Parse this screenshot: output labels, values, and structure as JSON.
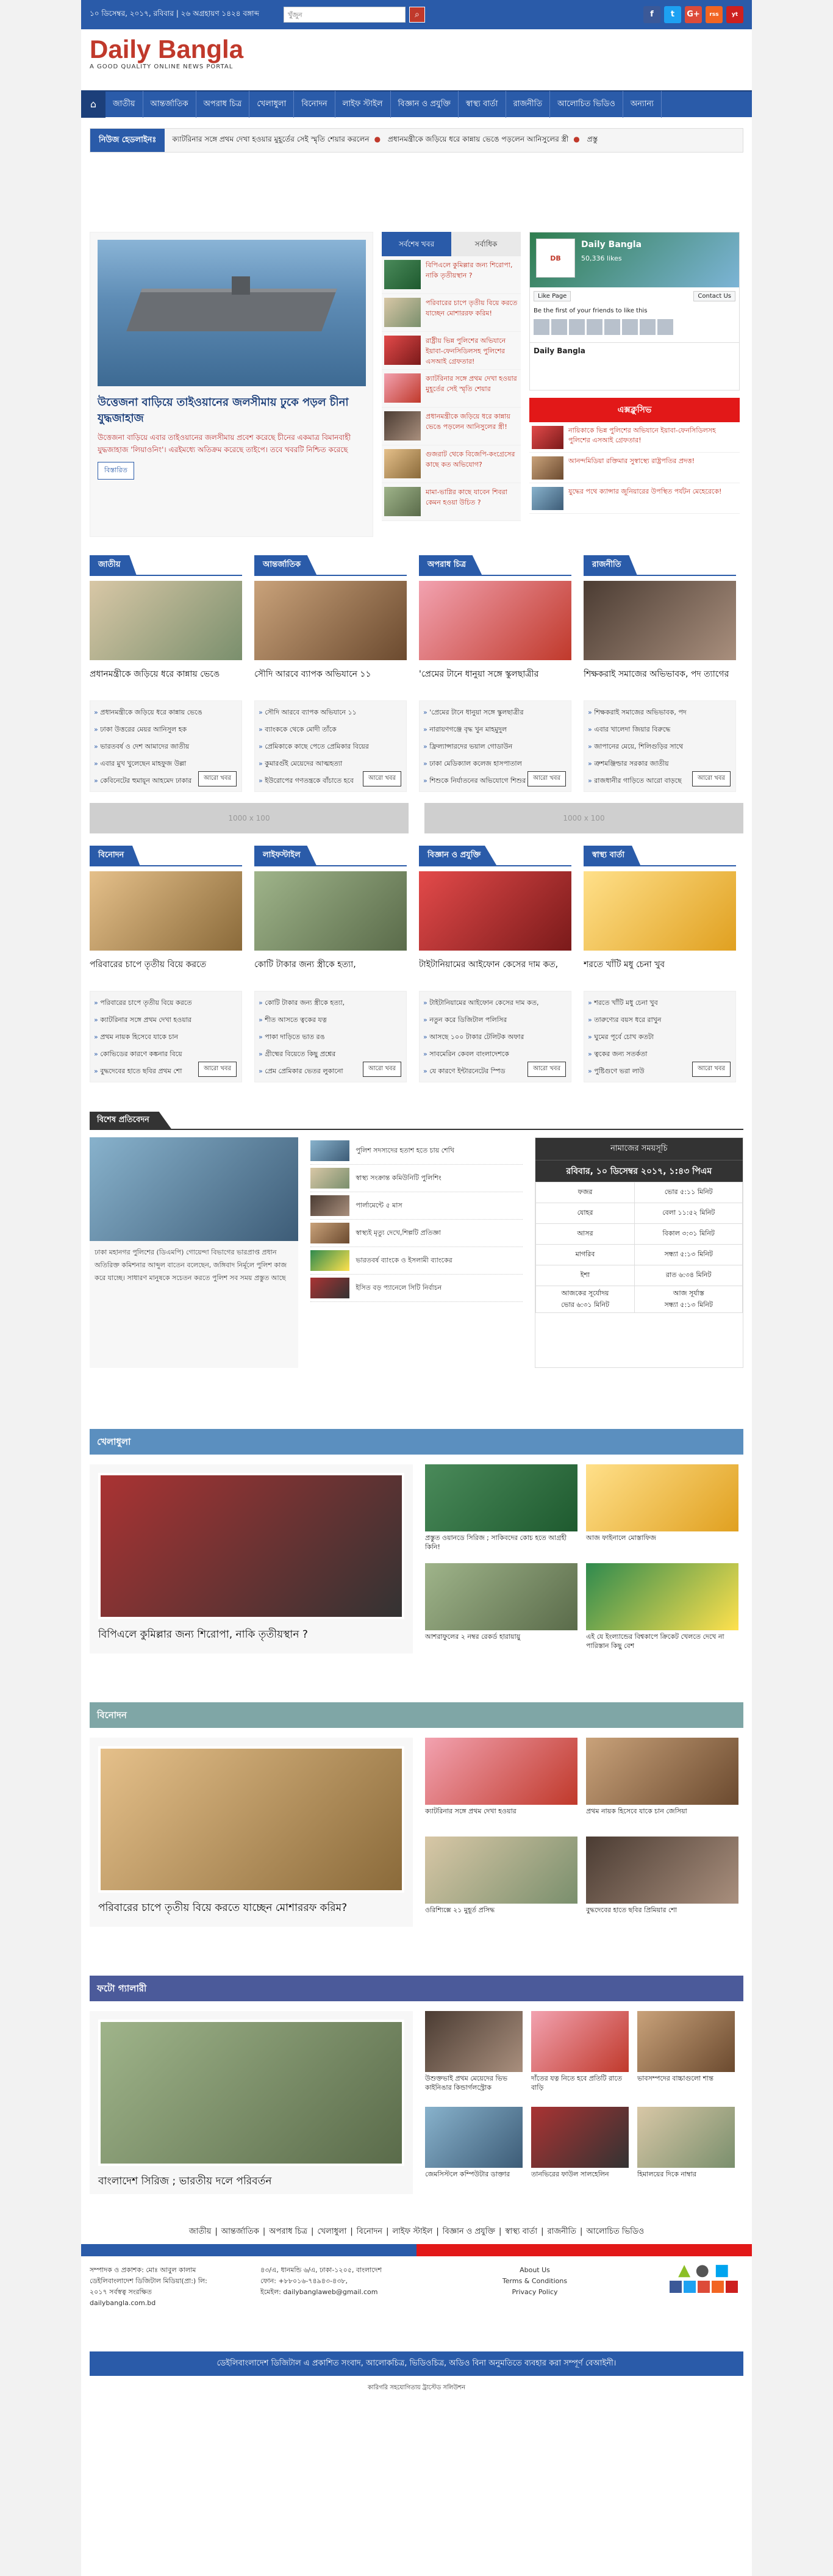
{
  "topbar": {
    "date": "১০ ডিসেম্বর, ২০১৭, রবিবার | ২৬ অগ্রহায়ণ ১৪২৪ বঙ্গাব্দ",
    "search_placeholder": "খুঁজুন",
    "social": [
      "f",
      "t",
      "G+",
      "rss",
      "yt"
    ]
  },
  "header": {
    "logo": "Daily Bangla",
    "tagline": "A GOOD QUALITY ONLINE NEWS PORTAL"
  },
  "nav": {
    "home": "⌂",
    "items": [
      "জাতীয়",
      "আন্তর্জাতিক",
      "অপরাধ চিত্র",
      "খেলাধুলা",
      "বিনোদন",
      "লাইফ স্টাইল",
      "বিজ্ঞান ও প্রযুক্তি",
      "স্বাস্থ্য বার্তা",
      "রাজনীতি",
      "আলোচিত ভিডিও",
      "অন্যান্য"
    ]
  },
  "ticker": {
    "label": "নিউজ হেডলাইনঃ",
    "items": [
      "ক্যাটরিনার সঙ্গে প্রথম দেখা হওয়ার মুহূর্তের সেই স্মৃতি শেয়ার করলেন",
      "প্রধানমন্ত্রীকে জড়িয়ে ধরে কান্নায় ভেঙে পড়লেন আনিসুলের স্ত্রী",
      "প্রস্তু"
    ]
  },
  "lead": {
    "title": "উত্তেজনা বাড়িয়ে তাইওয়ানের জলসীমায় ঢুকে পড়ল চীনা যুদ্ধজাহাজ",
    "summary": "উত্তেজনা বাড়িয়ে এবার তাইওয়ানের জলসীমায় প্রবেশ করেছে চীনের একমাত্র বিমানবাহী যুদ্ধজাহাজ 'লিয়াওনিং'। এরইমধ্যে অতিক্রম করেছে তাইপে। তবে খবরটি নিশ্চিত করেছে",
    "more": "বিস্তারিত"
  },
  "tabs": {
    "latest": "সর্বশেষ খবর",
    "popular": "সর্বাধিক",
    "items": [
      "বিপিএলে কুমিল্লার জন্য শিরোপা, নাকি তৃতীয়স্থান ?",
      "পরিবারের চাপে তৃতীয় বিয়ে করতে যাচ্ছেন মোশাররফ করিম!",
      "রাষ্ট্রীয় ভিন্ন পুলিশের অভিযানে ইয়াবা-ফেনসিডিলসহ পুলিশের এসআই গ্রেফতার!",
      "ক্যাটরিনার সঙ্গে প্রথম দেখা হওয়ার মুহূর্তের সেই স্মৃতি শেয়ার",
      "প্রধানমন্ত্রীকে জড়িয়ে ধরে কান্নায় ভেঙে পড়লেন আনিসুলের স্ত্রী!",
      "গুজরাট থেকে বিজেপি-কংগ্রেসের কাছে কত অভিযোগ?",
      "মামা-ভাগ্নির কাছে যাবেন শিবরা কেমন হওয়া উচিত ?"
    ]
  },
  "facebook": {
    "name": "Daily Bangla",
    "likes": "50,336 likes",
    "like_btn": "Like Page",
    "contact_btn": "Contact Us",
    "friends_text": "Be the first of your friends to like this",
    "post_title": "Daily Bangla"
  },
  "popular": {
    "label": "এক্সক্লুসিভ",
    "items": [
      "নায়িকাকে ভিন্ন পুলিশের অভিযানে ইয়াবা-ফেনসিডিলসহ পুলিশের এসআই গ্রেফতার!",
      "আনন্দমিডিয়া রক্তিমার সুস্বাস্থ্যে রাষ্ট্রপতির প্রদত্ত!",
      "যুদ্ধের পথে ক্যান্সার জুনিয়ারের উপস্থিত পর্যটন মেহেরেকে!"
    ]
  },
  "sections1": [
    {
      "title": "জাতীয়",
      "headline": "প্রধানমন্ত্রীকে জড়িয়ে ধরে কান্নায় ভেঙে",
      "items": [
        "প্রধানমন্ত্রীকে জড়িয়ে ধরে কান্নায় ভেঙে",
        "ঢাকা উত্তরের মেয়র আনিসুল হক",
        "ভারতবর্ষ ও দেশ আমাদের জাতীয়",
        "এবার মুখ খুলেছেন মাহফুজ উল্লা",
        "কেবিনেটের হুমায়ূন আহমেদ ঢাকার"
      ],
      "more": "আরো খবর"
    },
    {
      "title": "আন্তর্জাতিক",
      "headline": "সৌদি আরবে ব্যাপক অভিযানে ১১",
      "items": [
        "সৌদি আরবে ব্যাপক অভিযানে ১১",
        "ব্যাংককে থেকে মোদী তাঁকে",
        "প্রেমিকাকে কাছে পেতে প্রেমিকার বিয়ের",
        "কুমারগুঁই মেয়েদের আত্মহত্যা",
        "ইউরোপের গণতন্ত্রকে বাঁচাতে হবে"
      ],
      "more": "আরো খবর"
    },
    {
      "title": "অপরাধ চিত্র",
      "headline": "'প্রেমের টানে ধানুয়া সঙ্গে স্কুলছাত্রীর",
      "items": [
        "'প্রেমের টানে ধানুয়া সঙ্গে স্কুলছাত্রীর",
        "নারায়ণগঞ্জে বৃদ্ধ খুন মাহমুদুল",
        "ফ্রিল্যান্সারদের ভয়াল গোডাউন",
        "ঢাকা মেডিক্যাল কলেজ হাসপাতাল",
        "শিশুকে নির্যাতনের অভিযোগে শিশুর"
      ],
      "more": "আরো খবর"
    },
    {
      "title": "রাজনীতি",
      "headline": "শিক্ষকরাই সমাজের অভিভাবক, পদ ত্যাগের",
      "items": [
        "শিক্ষকরাই সমাজের অভিভাবক, পদ",
        "এবার খালেদা জিয়ার বিরুদ্ধে",
        "জাপানের মেয়ে, শিলিগুড়ির সাথে",
        "ত্রুশমঞ্জিল্ডার সরকার জাতীয়",
        "রাজধানীর গাড়িতে আরো বাড়ছে"
      ],
      "more": "আরো খবর"
    }
  ],
  "ads": [
    "1000 x 100",
    "1000 x 100"
  ],
  "sections2": [
    {
      "title": "বিনোদন",
      "headline": "পরিবারের চাপে তৃতীয় বিয়ে করতে",
      "items": [
        "পরিবারের চাপে তৃতীয় বিয়ে করতে",
        "ক্যাটরিনার সঙ্গে প্রথম দেখা হওয়ার",
        "প্রথম নায়ক হিসেবে যাকে চান",
        "কোভিডের কারণে কঙ্কনার বিয়ে",
        "বুদ্ধদেবের হাতে ছবির প্রথম শো"
      ],
      "more": "আরো খবর"
    },
    {
      "title": "লাইফস্টাইল",
      "headline": "কোটি টাকার জন্য স্ত্রীকে হত্যা,",
      "items": [
        "কোটি টাকার জন্য স্ত্রীকে হত্যা,",
        "শীত আসতে ত্বকের যত্ন",
        "পাকা দাড়িতে ভাত রঙ",
        "গ্রীষ্মের বিয়েতে কিছু প্রশ্নের",
        "প্রেম প্রেমিকার ভেতর লুকানো"
      ],
      "more": "আরো খবর"
    },
    {
      "title": "বিজ্ঞান ও প্রযুক্তি",
      "headline": "টাইটানিয়ামের আইফোন কেসের দাম কত,",
      "items": [
        "টাইটানিয়ামের আইফোন কেসের দাম কত,",
        "নতুন করে ডিজিটাল পলিসির",
        "আসছে ১০০ টাকার টেলিটক অফার",
        "সাবমেরিন কেবল বাংলাদেশকে",
        "যে কারণে ইন্টারনেটের স্পিড"
      ],
      "more": "আরো খবর"
    },
    {
      "title": "স্বাস্থ্য বার্তা",
      "headline": "শরতে খাঁটি মধু চেনা খুব",
      "items": [
        "শরতে খাঁটি মধু চেনা খুব",
        "তারুণ্যের বয়স ধরে রাখুন",
        "ঘুমের পূর্বে চোখ কতটা",
        "ত্বকের জন্য সতর্কতা",
        "পুষ্টিগুণে ভরা লাউ"
      ],
      "more": "আরো খবর"
    }
  ],
  "special": {
    "title": "বিশেষ প্রতিবেদন",
    "summary": "ঢাকা মহানগর পুলিশের (ডিএমপি) গোয়েন্দা বিভাগের ভারপ্রাপ্ত প্রধান অতিরিক্ত কমিশনার আব্দুল বাতেন বলেছেন, জঙ্গিবাদ নির্মূলে পুলিশ কাজ করে যাচ্ছে। সাধারণ মানুষকে সচেতন করতে পুলিশ সব সময় প্রস্তুত আছে",
    "list": [
      "পুলিশ সদস্যদের হতাশ হতে চায় শেখি",
      "স্বাস্থ্য সংক্রান্ত কমিউনিটি পুলিশিং",
      "পার্লামেন্টে ৫ মাস",
      "স্বাস্থ্যই মৃত্যু দেখে,শিল্পটি প্রতিজ্ঞা",
      "ভারতবর্ষ ব্যাংকে ও ইসলামী ব্যাংকের",
      "ইসিত বড় প্যানেলে সিটি নির্বাচন"
    ]
  },
  "prayer": {
    "title": "নামাজের সময়সূচি",
    "date": "রবিবার, ১০ ডিসেম্বর ২০১৭, ১:৪৩ পিএম",
    "rows": [
      [
        "ফজর",
        "ভোর ৫:১১ মিনিট"
      ],
      [
        "যোহর",
        "বেলা ১১:৫২ মিনিট"
      ],
      [
        "আসর",
        "বিকাল ৩:৩১ মিনিট"
      ],
      [
        "মাগরিব",
        "সন্ধ্যা ৫:১৩ মিনিট"
      ],
      [
        "ইশা",
        "রাত ৬:৩৪ মিনিট"
      ],
      [
        "আজকের সূর্যোদয়\nভোর ৬:৩১ মিনিট",
        "আজ সূর্যাস্ত\nসন্ধ্যা ৫:১৩ মিনিট"
      ]
    ]
  },
  "sports": {
    "title": "খেলাধুলা",
    "headline": "বিপিএলে কুমিল্লার জন্য শিরোপা, নাকি তৃতীয়স্থান ?",
    "items": [
      "প্রস্তুত ওয়ানডে সিরিজ ; সাকিবদের কোচ হতে আগ্রহী কিনি!",
      "আজ ফাইনালে মোস্তাফিজ",
      "আশরাফুলের ২ নম্বর রেকর্ড হারায়ায়ু",
      "এই যে ইংল্যান্ডের বিশ্বকাপে ক্রিকেট খেলতে দেখে না পারিস্তান কিছু বেশ"
    ]
  },
  "entertainment": {
    "title": "বিনোদন",
    "headline": "পরিবারের চাপে তৃতীয় বিয়ে করতে যাচ্ছেন মোশাররফ করিম?",
    "items": [
      "ক্যাটরিনার সঙ্গে প্রথম দেখা হওয়ার",
      "প্রথম নায়ক হিসেবে যাকে চান জেসিয়া",
      "ওরিশ্যিক্সে ২১ মুহূর্ত প্রসিদ্ধ",
      "বুদ্ধদেবের হাতে ছবির প্রিমিয়ার শো"
    ]
  },
  "gallery": {
    "title": "ফটো গ্যালারী",
    "headline": "বাংলাদেশ সিরিজ ; ভারতীয় দলে পরিবর্তন",
    "items": [
      "উশুক্তভাই প্রথম মেয়েদের ভিভ কাইনিঙার কিন্ডার্গলস্ট্রোক",
      "দাঁতের যত্ন নিতে হবে প্রতিটি রাতে বাড়ি",
      "ভাবসম্পদের বাচ্চাগুলো শান্ত",
      "জেমসিস্টলে কম্পিউটার ডাক্তার",
      "তানভিরের ফাউল সালহেলিন",
      "হিমালয়ের দিকে নাম্বার"
    ]
  },
  "footer": {
    "nav": [
      "জাতীয়",
      "আন্তর্জাতিক",
      "অপরাধ চিত্র",
      "খেলাধুলা",
      "বিনোদন",
      "লাইফ স্টাইল",
      "বিজ্ঞান ও প্রযুক্তি",
      "স্বাস্থ্য বার্তা",
      "রাজনীতি",
      "আলোচিত ভিডিও"
    ],
    "editor": "সম্পাদক ও প্রকাশক: মোঃ আবুল কালাম\nডেইলিবাংলাদেশ ডিজিটাল মিডিয়া(প্রা:) লি:\n২০১৭ সর্বস্বত্ব সংরক্ষিত\ndailybangla.com.bd",
    "address": "৪৩/এ, ধানমন্ডি ৬/এ, ঢাকা-১২০৫, বাংলাদেশ\nফোন: +৮৮০১৬-৭৪৯৪৩-৪৩৮,\nইমেইল: dailybanglaweb@gmail.com",
    "links": [
      "About Us",
      "Terms & Conditions",
      "Privacy Policy"
    ],
    "copyright": "ডেইলিবাংলাদেশ ডিজিটাল এ প্রকাশিত সংবাদ, আলোকচিত্র, ভিডিওচিত্র, অডিও বিনা অনুমতিতে ব্যবহার করা সম্পূর্ণ বেআইনী।",
    "credit": "কারিগরি সহযোগিতায় ট্রাস্টেড সলিউশন"
  }
}
